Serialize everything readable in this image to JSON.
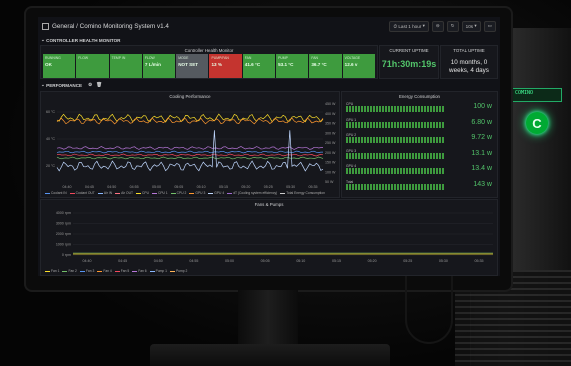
{
  "dashboard": {
    "breadcrumb": "General / Comino Monitoring System v1.4",
    "time_range": "Last 1 hour",
    "refresh": "10s"
  },
  "sections": {
    "controller": "CONTROLLER HEALTH MONITOR",
    "performance": "PERFORMANCE"
  },
  "health_monitor": {
    "title": "Controller Health Monitor",
    "tiles": [
      {
        "label": "RUNNING",
        "value": "OK",
        "color": "#3e9b3e"
      },
      {
        "label": "FLOW",
        "value": "",
        "color": "#3e9b3e"
      },
      {
        "label": "TEMP IN",
        "value": "",
        "color": "#3e9b3e"
      },
      {
        "label": "FLOW",
        "value": "7 L/min",
        "color": "#3e9b3e"
      },
      {
        "label": "MODE",
        "value": "NOT SET",
        "color": "#555a60"
      },
      {
        "label": "PUMP/FAN",
        "value": "13 %",
        "color": "#c4342f"
      },
      {
        "label": "FAN",
        "value": "41.6 °C",
        "color": "#3e9b3e"
      },
      {
        "label": "PUMP",
        "value": "53.1 °C",
        "color": "#3e9b3e"
      },
      {
        "label": "FAN",
        "value": "36.7 °C",
        "color": "#3e9b3e"
      },
      {
        "label": "VOLTAGE",
        "value": "12.6 v",
        "color": "#3e9b3e"
      }
    ]
  },
  "uptime": {
    "current_title": "CURRENT UPTIME",
    "current_value": "71h:30m:19s",
    "total_title": "TOTAL UPTIME",
    "total_value": "10 months, 0 weeks, 4 days"
  },
  "cooling": {
    "title": "Cooling Performance",
    "y_left_ticks": [
      "60 °C",
      "40 °C",
      "20 °C"
    ],
    "y_right_ticks": [
      "450 W",
      "400 W",
      "350 W",
      "300 W",
      "250 W",
      "200 W",
      "150 W",
      "100 W",
      "50 W"
    ],
    "x_ticks": [
      "04:40",
      "04:45",
      "04:50",
      "04:55",
      "05:00",
      "05:05",
      "05:10",
      "05:15",
      "05:20",
      "05:25",
      "05:30",
      "05:35"
    ],
    "legend": [
      {
        "name": "Coolant IN",
        "color": "#5794f2"
      },
      {
        "name": "Coolant OUT",
        "color": "#f2495c"
      },
      {
        "name": "Air IN",
        "color": "#8ab8ff"
      },
      {
        "name": "Air OUT",
        "color": "#ff7383"
      },
      {
        "name": "CPU",
        "color": "#fade2a"
      },
      {
        "name": "CPU 1",
        "color": "#b877d9"
      },
      {
        "name": "CPU 2",
        "color": "#73bf69"
      },
      {
        "name": "GPU 3",
        "color": "#ff9830"
      },
      {
        "name": "GPU 4",
        "color": "#c0d8ff"
      },
      {
        "name": "dT (Cooling system efficiency)",
        "color": "#a16bd1"
      },
      {
        "name": "Total Energy Consumption",
        "color": "#cccccc"
      }
    ]
  },
  "energy": {
    "title": "Energy Consumption",
    "rows": [
      {
        "label": "CPU",
        "value": "100 w",
        "fill": 0.62
      },
      {
        "label": "GPU 1",
        "value": "6.80 w",
        "fill": 0.62
      },
      {
        "label": "GPU 2",
        "value": "9.72 w",
        "fill": 0.62
      },
      {
        "label": "GPU 3",
        "value": "13.1 w",
        "fill": 0.62
      },
      {
        "label": "GPU 4",
        "value": "13.4 w",
        "fill": 0.62
      },
      {
        "label": "Total",
        "value": "143 w",
        "fill": 0.62
      }
    ]
  },
  "fans": {
    "title": "Fans & Pumps",
    "y_ticks": [
      "4000 rpm",
      "3000 rpm",
      "2000 rpm",
      "1000 rpm",
      "0 rpm"
    ],
    "x_ticks": [
      "04:40",
      "04:45",
      "04:50",
      "04:55",
      "05:00",
      "05:05",
      "05:10",
      "05:15",
      "05:20",
      "05:25",
      "05:30",
      "05:35"
    ],
    "legend": [
      {
        "name": "Fan 1",
        "color": "#fade2a"
      },
      {
        "name": "Fan 2",
        "color": "#73bf69"
      },
      {
        "name": "Fan 3",
        "color": "#5794f2"
      },
      {
        "name": "Fan 4",
        "color": "#ff9830"
      },
      {
        "name": "Fan 5",
        "color": "#f2495c"
      },
      {
        "name": "Fan 6",
        "color": "#b877d9"
      },
      {
        "name": "Pump 1",
        "color": "#8ab8ff"
      },
      {
        "name": "Pump 2",
        "color": "#ffb357"
      }
    ]
  },
  "tower_panel_text": "COMINO",
  "tower_logo": "C"
}
